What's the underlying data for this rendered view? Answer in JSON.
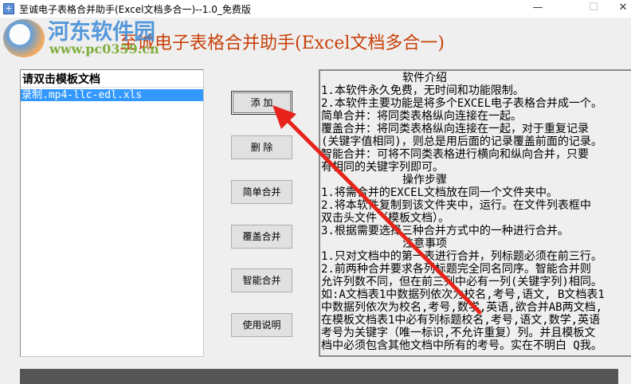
{
  "window": {
    "title": "至诚电子表格合并助手(Excel文档多合一)--1.0_免费版",
    "minimize": "—",
    "maximize": "☐",
    "close": "✕"
  },
  "watermark": {
    "name": "河东软件园",
    "url": "www.pc0359.cn"
  },
  "app_title": "至诚电子表格合并助手(Excel文档多合一)",
  "list": {
    "header": "请双击模板文档",
    "items": [
      "录制.mp4-llc-edl.xls"
    ]
  },
  "buttons": {
    "add": "添  加",
    "delete": "删  除",
    "simple": "简单合并",
    "cover": "覆盖合并",
    "smart": "智能合并",
    "help": "使用说明"
  },
  "info": {
    "lines": [
      "软件介绍",
      "1.本软件永久免费，无时间和功能限制。",
      "2.本软件主要功能是将多个EXCEL电子表格合并成一个。",
      "简单合并：将同类表格纵向连接在一起。",
      "覆盖合并：将同类表格纵向连接在一起，对于重复记录",
      "(关键字值相同)，则总是用后面的记录覆盖前面的记录。",
      "智能合并：可将不同类表格进行横向和纵向合并，只要",
      "有相同的关键字列即可。",
      "操作步骤",
      "1.将需合并的EXCEL文档放在同一个文件夹中。",
      "2.将本软件复制到该文件夹中，运行。在文件列表框中",
      "双击头文件（模板文档）。",
      "3.根据需要选择三种合并方式中的一种进行合并。",
      "注意事项",
      "1.只对文档中的第一表进行合并，列标题必须在前三行。",
      "2.前两种合并要求各列标题完全同名同序。智能合并则",
      "允许列数不同，但在前三列中必有一列(关键字列)相同。",
      "如:A文档表1中数据列依次为校名,考号,语文, B文档表1",
      "中数据列依次为校名,考号,数学,英语,欲合并AB两文档,",
      "在模板文档表1中必有列标题校名,考号,语文,数学,英语",
      "考号为关键字（唯一标识,不允许重复）列。并且模板文",
      "档中必须包含其他文档中所有的考号。实在不明白 Q我。"
    ]
  }
}
